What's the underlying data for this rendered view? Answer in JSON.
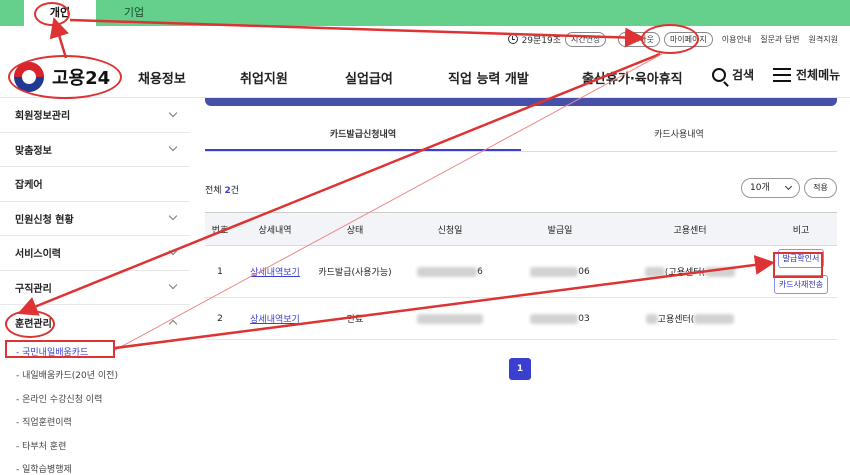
{
  "tabs": {
    "personal": "개인",
    "company": "기업"
  },
  "util": {
    "timer": "29분19초",
    "extend": "시간연장",
    "logout": "로그아웃",
    "mypage": "마이페이지",
    "links": [
      "이용안내",
      "질문과 답변",
      "원격지원"
    ]
  },
  "logo": {
    "text": "고용24"
  },
  "gnb": [
    "채용정보",
    "취업지원",
    "실업급여",
    "직업 능력 개발",
    "출산휴가·육아휴직"
  ],
  "header": {
    "search": "검색",
    "menu": "전체메뉴"
  },
  "sidebar": {
    "items": [
      "회원정보관리",
      "맞춤정보",
      "잡케어",
      "민원신청 현황",
      "서비스이력",
      "구직관리",
      "훈련관리"
    ],
    "sub": [
      "- 국민내일배움카드",
      "- 내일배움카드(20년 이전)",
      "- 온라인 수강신청 이력",
      "- 직업훈련이력",
      "- 타부처 훈련",
      "- 일학습병행제"
    ]
  },
  "content": {
    "tabs": [
      "카드발급신청내역",
      "카드사용내역"
    ],
    "total_label": "전체",
    "total_count": "2",
    "total_suffix": "건",
    "per_page": "10개",
    "apply": "적용",
    "columns": [
      "번호",
      "상세내역",
      "상태",
      "신청일",
      "발급일",
      "고용센터",
      "비고"
    ],
    "rows": [
      {
        "no": "1",
        "detail": "상세내역보기",
        "status": "카드발급(사용가능)",
        "apply_date_tail": "6",
        "issue_date_tail": "06",
        "center": "(고용센터(",
        "actions": [
          "발급확인서",
          "카드사재전송"
        ]
      },
      {
        "no": "2",
        "detail": "상세내역보기",
        "status": "만료",
        "apply_date_tail": "",
        "issue_date_tail": "03",
        "center": "고용센터(",
        "actions": []
      }
    ],
    "page": "1"
  },
  "colors": {
    "accent": "#3a3fd0",
    "topbar": "#64d08c",
    "annotation": "#dd3333"
  }
}
